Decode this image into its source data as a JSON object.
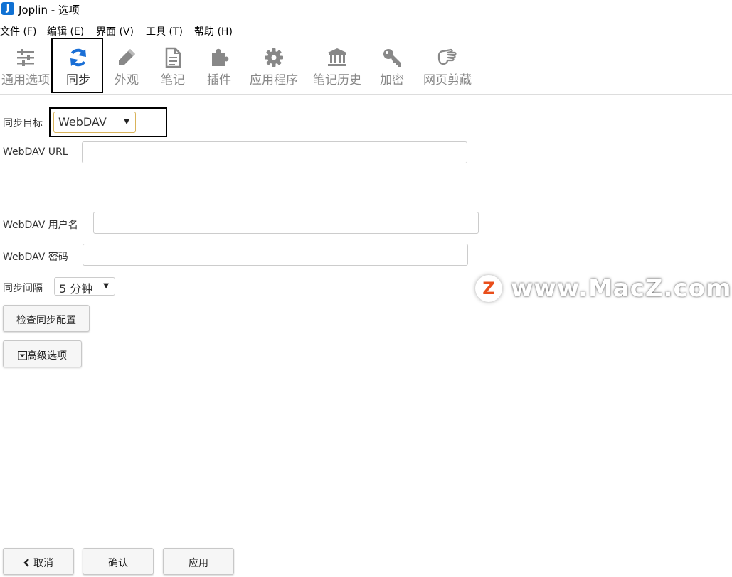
{
  "window": {
    "title": "Joplin - 选项",
    "app_icon": "joplin-logo",
    "app_icon_letter": "J",
    "brand_color": "#1071d3"
  },
  "menubar": {
    "items": [
      "文件 (F)",
      "编辑 (E)",
      "界面 (V)",
      "工具 (T)",
      "帮助 (H)"
    ]
  },
  "toolbar": {
    "items": [
      {
        "label": "通用选项",
        "icon": "sliders-icon",
        "active": false
      },
      {
        "label": "同步",
        "icon": "sync-icon",
        "active": true
      },
      {
        "label": "外观",
        "icon": "pencil-icon",
        "active": false
      },
      {
        "label": "笔记",
        "icon": "document-icon",
        "active": false
      },
      {
        "label": "插件",
        "icon": "puzzle-icon",
        "active": false
      },
      {
        "label": "应用程序",
        "icon": "gear-icon",
        "active": false
      },
      {
        "label": "笔记历史",
        "icon": "archive-icon",
        "active": false
      },
      {
        "label": "加密",
        "icon": "key-icon",
        "active": false
      },
      {
        "label": "网页剪藏",
        "icon": "hand-icon",
        "active": false
      }
    ],
    "active_color": "#1a6fd6",
    "inactive_color": "#888888"
  },
  "form": {
    "sync_target": {
      "label": "同步目标",
      "value": "WebDAV"
    },
    "webdav_url": {
      "label": "WebDAV URL",
      "value": ""
    },
    "webdav_username": {
      "label": "WebDAV 用户名",
      "value": ""
    },
    "webdav_password": {
      "label": "WebDAV 密码",
      "value": ""
    },
    "sync_interval": {
      "label": "同步间隔",
      "value": "5 分钟"
    },
    "check_button": "检查同步配置",
    "advanced_button": "高级选项"
  },
  "footer": {
    "cancel": "取消",
    "ok": "确认",
    "apply": "应用"
  },
  "watermark": {
    "badge": "Z",
    "text": "www.MacZ.com"
  }
}
